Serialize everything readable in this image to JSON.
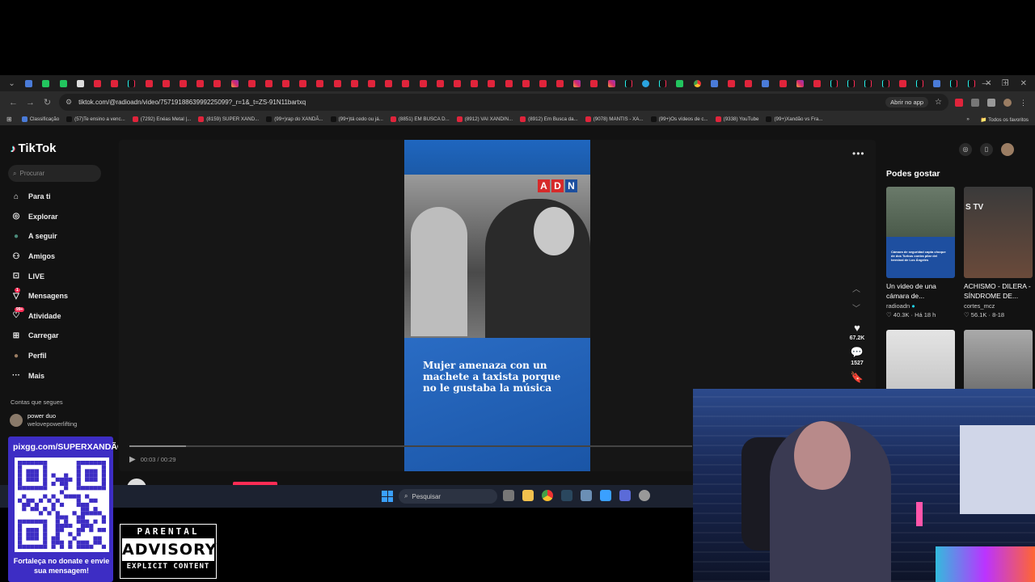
{
  "browser": {
    "url": "tiktok.com/@radioadn/video/7571918863999225099?_r=1&_t=ZS-91N11bartxq",
    "open_in_app": "Abrir no app",
    "bookmarks": [
      {
        "label": "Classificação",
        "color": "#4a7bd8"
      },
      {
        "label": "(57)Te ensino a venc...",
        "color": "#111111"
      },
      {
        "label": "(7292) Enéas Metal |...",
        "color": "#e0243b"
      },
      {
        "label": "(8159) SUPER XAND...",
        "color": "#e0243b"
      },
      {
        "label": "(99+)rap do XANDÃ...",
        "color": "#111111"
      },
      {
        "label": "(99+)tá cedo ou já...",
        "color": "#111111"
      },
      {
        "label": "(8851) EM BUSCA D...",
        "color": "#e0243b"
      },
      {
        "label": "(8912) VAI XANDIN...",
        "color": "#e0243b"
      },
      {
        "label": "(8912) Em Busca da...",
        "color": "#e0243b"
      },
      {
        "label": "(9078) MANTIS - XA...",
        "color": "#e0243b"
      },
      {
        "label": "(99+)Os vídeos de c...",
        "color": "#111111"
      },
      {
        "label": "(9338) YouTube",
        "color": "#e0243b"
      },
      {
        "label": "(99+)Xandão vs Fra...",
        "color": "#111111"
      }
    ],
    "all_bookmarks": "Todos os favoritos"
  },
  "tiktok": {
    "logo": "TikTok",
    "search_placeholder": "Procurar",
    "nav": [
      {
        "label": "Para ti",
        "icon": "home-icon",
        "badge": ""
      },
      {
        "label": "Explorar",
        "icon": "compass-icon",
        "badge": ""
      },
      {
        "label": "A seguir",
        "icon": "following-avatar-icon",
        "badge": ""
      },
      {
        "label": "Amigos",
        "icon": "friends-icon",
        "badge": ""
      },
      {
        "label": "LIVE",
        "icon": "live-icon",
        "badge": ""
      },
      {
        "label": "Mensagens",
        "icon": "messages-icon",
        "badge": "1"
      },
      {
        "label": "Atividade",
        "icon": "activity-icon",
        "badge": "99+"
      },
      {
        "label": "Carregar",
        "icon": "upload-icon",
        "badge": ""
      },
      {
        "label": "Perfil",
        "icon": "profile-icon",
        "badge": ""
      },
      {
        "label": "Mais",
        "icon": "more-icon",
        "badge": ""
      }
    ],
    "following_heading": "Contas que segues",
    "following_account": {
      "name": "power duo",
      "handle": "welovepowerlifting"
    },
    "video": {
      "headline": "Mujer amenaza con un machete a taxista porque no le gustaba la música",
      "logo_letters": [
        "A",
        "D",
        "N"
      ],
      "time": "00:03 / 00:29",
      "progress": 0.1,
      "author": "radioadn",
      "likes": "67.2K",
      "comments": "1527"
    },
    "may_like_heading": "Podes gostar",
    "suggestions": [
      {
        "title": "Un video de una cámara de...",
        "user": "radioadn",
        "verified": true,
        "stats": "♡ 40.3K · Há 18 h",
        "caption": "Cámara de seguridad capta choque de dos Turbus contra pilar del terminal de Los Ángeles"
      },
      {
        "title": "ACHISMO - DILERA - SÍNDROME DE...",
        "user": "cortes_mcz",
        "verified": false,
        "stats": "♡ 56.1K · 8-18",
        "caption": "S TV"
      },
      {
        "title": "",
        "user": "",
        "verified": false,
        "stats": "",
        "caption": ""
      },
      {
        "title": "",
        "user": "",
        "verified": false,
        "stats": "",
        "caption": ""
      }
    ]
  },
  "taskbar": {
    "search_placeholder": "Pesquisar"
  },
  "overlay": {
    "donate_url": "pixgg.com/SUPERXANDÃO",
    "donate_message": "Fortaleça no donate e envie sua mensagem!",
    "parental_line1": "PARENTAL",
    "parental_line2": "ADVISORY",
    "parental_line3": "EXPLICIT CONTENT"
  }
}
